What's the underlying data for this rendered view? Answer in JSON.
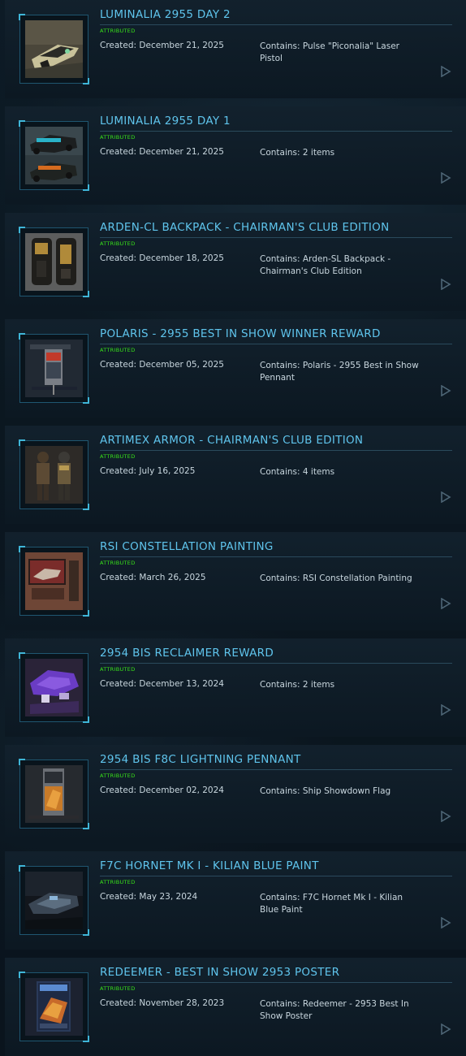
{
  "colors": {
    "title": "#5fc4ec",
    "badge": "#39e619",
    "text": "#c8d6de",
    "accent": "#3fb6d8"
  },
  "pledges": [
    {
      "title": "LUMINALIA 2955 DAY 2",
      "badge": "ATTRIBUTED",
      "created": "Created: December 21, 2025",
      "contains": "Contains: Pulse \"Piconalia\" Laser Pistol",
      "thumbnail": "laser-pistol-thumbnail",
      "arrow": "play-arrow-icon"
    },
    {
      "title": "LUMINALIA 2955 DAY 1",
      "badge": "ATTRIBUTED",
      "created": "Created: December 21, 2025",
      "contains": "Contains: 2 items",
      "thumbnail": "vehicle-pair-thumbnail",
      "arrow": "play-arrow-icon"
    },
    {
      "title": "ARDEN-CL BACKPACK - CHAIRMAN'S CLUB EDITION",
      "badge": "ATTRIBUTED",
      "created": "Created: December 18, 2025",
      "contains": "Contains: Arden-SL Backpack - Chairman's Club Edition",
      "thumbnail": "backpack-thumbnail",
      "arrow": "play-arrow-icon"
    },
    {
      "title": "POLARIS - 2955 BEST IN SHOW WINNER REWARD",
      "badge": "ATTRIBUTED",
      "created": "Created: December 05, 2025",
      "contains": "Contains: Polaris - 2955 Best in Show Pennant",
      "thumbnail": "pennant-thumbnail",
      "arrow": "play-arrow-icon"
    },
    {
      "title": "ARTIMEX ARMOR - CHAIRMAN'S CLUB EDITION",
      "badge": "ATTRIBUTED",
      "created": "Created: July 16, 2025",
      "contains": "Contains: 4 items",
      "thumbnail": "armor-thumbnail",
      "arrow": "play-arrow-icon"
    },
    {
      "title": "RSI CONSTELLATION PAINTING",
      "badge": "ATTRIBUTED",
      "created": "Created: March 26, 2025",
      "contains": "Contains: RSI Constellation Painting",
      "thumbnail": "painting-thumbnail",
      "arrow": "play-arrow-icon"
    },
    {
      "title": "2954 BIS RECLAIMER REWARD",
      "badge": "ATTRIBUTED",
      "created": "Created: December 13, 2024",
      "contains": "Contains: 2 items",
      "thumbnail": "reclaimer-model-thumbnail",
      "arrow": "play-arrow-icon"
    },
    {
      "title": "2954 BIS F8C LIGHTNING PENNANT",
      "badge": "ATTRIBUTED",
      "created": "Created: December 02, 2024",
      "contains": "Contains: Ship Showdown Flag",
      "thumbnail": "flag-thumbnail",
      "arrow": "play-arrow-icon"
    },
    {
      "title": "F7C HORNET MK I - KILIAN BLUE PAINT",
      "badge": "ATTRIBUTED",
      "created": "Created: May 23, 2024",
      "contains": "Contains: F7C Hornet Mk I - Kilian Blue Paint",
      "thumbnail": "hornet-ship-thumbnail",
      "arrow": "play-arrow-icon"
    },
    {
      "title": "REDEEMER - BEST IN SHOW 2953 POSTER",
      "badge": "ATTRIBUTED",
      "created": "Created: November 28, 2023",
      "contains": "Contains: Redeemer - 2953 Best In Show Poster",
      "thumbnail": "poster-thumbnail",
      "arrow": "play-arrow-icon"
    }
  ]
}
